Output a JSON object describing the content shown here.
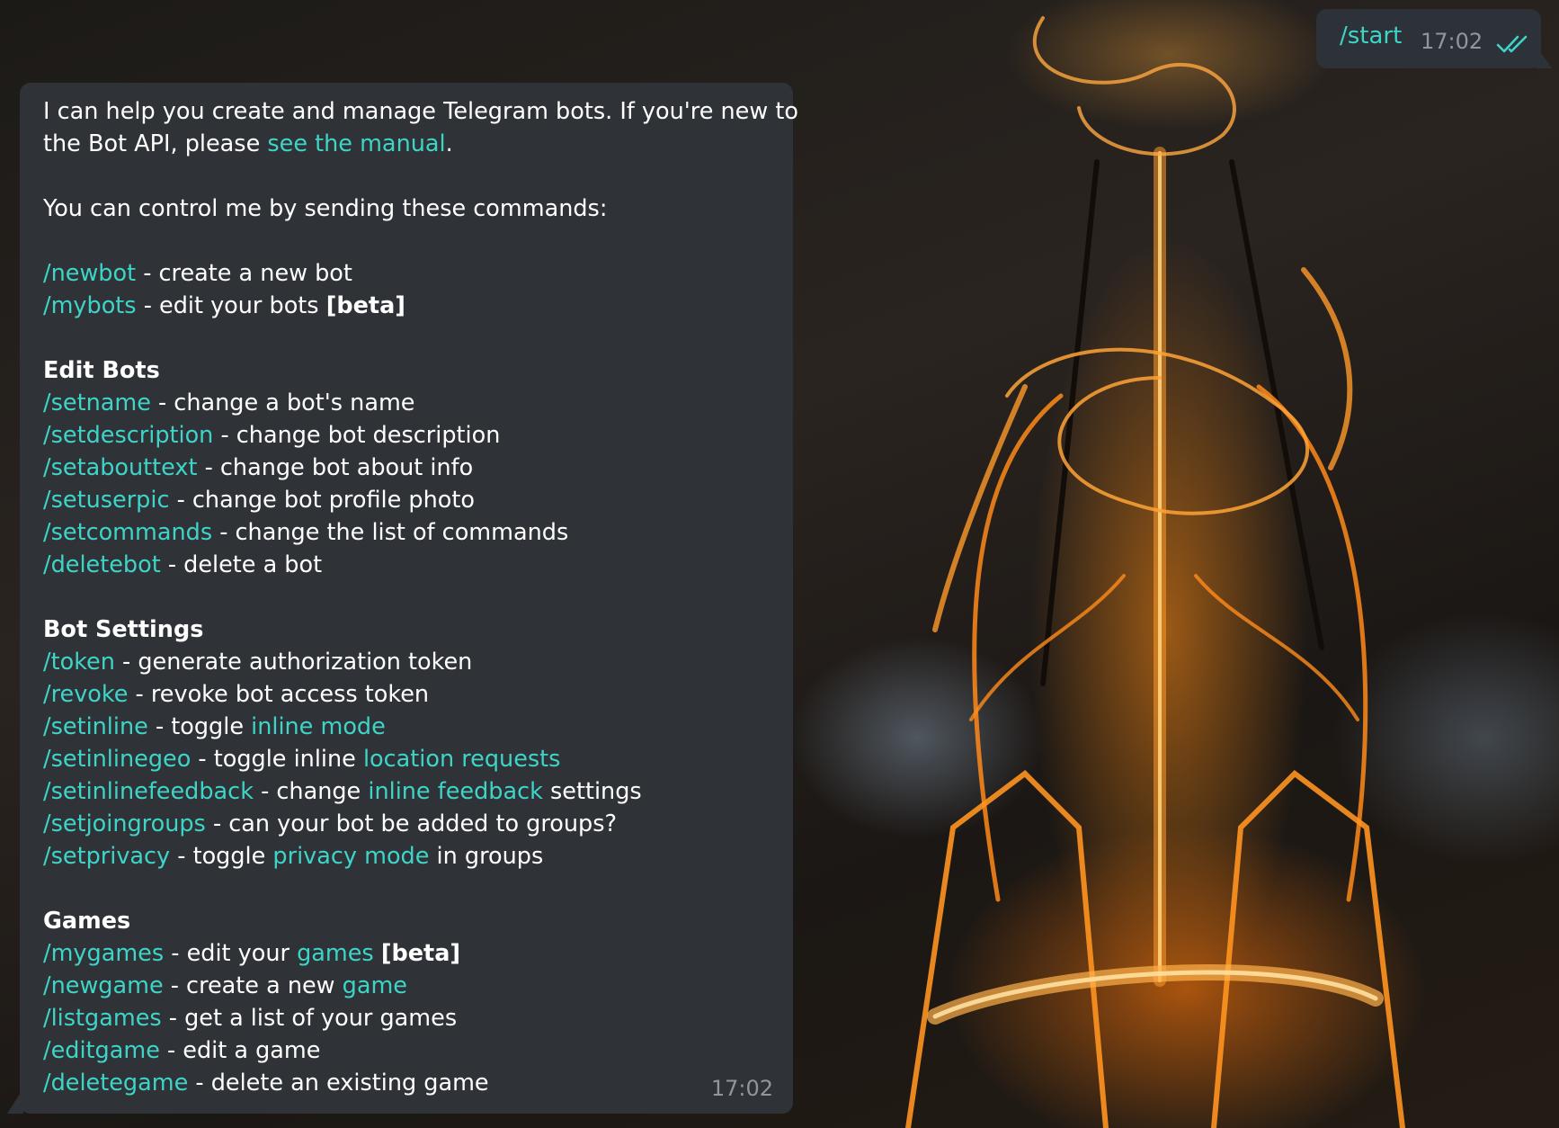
{
  "outgoing": {
    "text": "/start",
    "time": "17:02",
    "status_icon": "double-check-read-icon"
  },
  "incoming": {
    "intro_1": "I can help you create and manage Telegram bots. If you're new to",
    "intro_2a": "the Bot API, please ",
    "intro_2_link": "see the manual",
    "intro_2b": ".",
    "control": "You can control me by sending these commands:",
    "top": [
      {
        "cmd": "/newbot",
        "desc": " - create a new bot"
      },
      {
        "cmd": "/mybots",
        "desc": " - edit your bots ",
        "bold": "[beta]"
      }
    ],
    "edit_title": "Edit Bots",
    "edit": [
      {
        "cmd": "/setname",
        "desc": " - change a bot's name"
      },
      {
        "cmd": "/setdescription",
        "desc": " - change bot description"
      },
      {
        "cmd": "/setabouttext",
        "desc": " - change bot about info"
      },
      {
        "cmd": "/setuserpic",
        "desc": " - change bot profile photo"
      },
      {
        "cmd": "/setcommands",
        "desc": " - change the list of commands"
      },
      {
        "cmd": "/deletebot",
        "desc": " - delete a bot"
      }
    ],
    "settings_title": "Bot Settings",
    "settings": [
      {
        "cmd": "/token",
        "desc": " - generate authorization token"
      },
      {
        "cmd": "/revoke",
        "desc": " - revoke bot access token"
      },
      {
        "cmd": "/setinline",
        "desc": " - toggle ",
        "link": "inline mode"
      },
      {
        "cmd": "/setinlinegeo",
        "desc": " - toggle inline ",
        "link": "location requests"
      },
      {
        "cmd": "/setinlinefeedback",
        "desc": " - change ",
        "link": "inline feedback",
        "after": " settings"
      },
      {
        "cmd": "/setjoingroups",
        "desc": " - can your bot be added to groups?"
      },
      {
        "cmd": "/setprivacy",
        "desc": " - toggle ",
        "link": "privacy mode",
        "after": " in groups"
      }
    ],
    "games_title": "Games",
    "games": [
      {
        "cmd": "/mygames",
        "desc": " - edit your ",
        "link": "games",
        "after": " ",
        "bold": "[beta]"
      },
      {
        "cmd": "/newgame",
        "desc": " - create a new ",
        "link": "game"
      },
      {
        "cmd": "/listgames",
        "desc": " - get a list of your games"
      },
      {
        "cmd": "/editgame",
        "desc": " - edit a game"
      },
      {
        "cmd": "/deletegame",
        "desc": " - delete an existing game"
      }
    ],
    "time": "17:02"
  },
  "colors": {
    "accent": "#3ed4c7",
    "bubble": "#2f3338",
    "meta": "#8f969d"
  }
}
